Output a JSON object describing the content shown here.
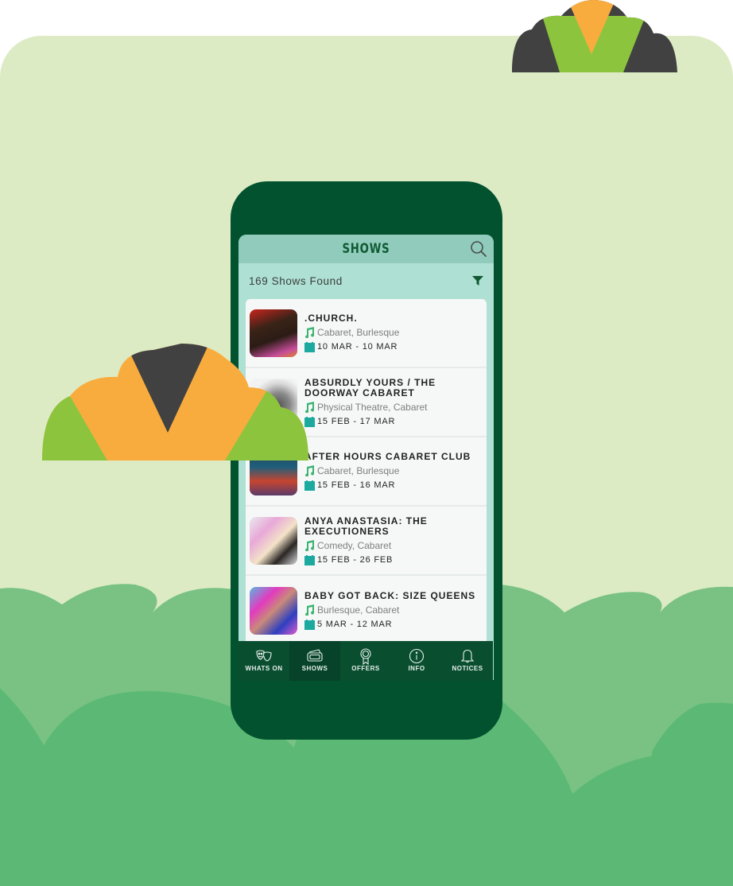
{
  "colors": {
    "panel_bg": "#ddebc5",
    "hill_light": "#79c283",
    "hill_dark": "#5cb975",
    "phone_body": "#02522f",
    "header_bg": "#90cbbb",
    "list_bg": "#aee0d3",
    "accent_teal": "#1ba9a0",
    "accent_green": "#3cb371",
    "cloud_orange": "#f9ac3e",
    "cloud_green": "#8dc43e",
    "cloud_dark": "#414141"
  },
  "app": {
    "title": "SHOWS",
    "results": "169 Shows Found"
  },
  "shows": [
    {
      "title": ".CHURCH.",
      "genres": "Cabaret, Burlesque",
      "dates": "10 MAR - 10 MAR"
    },
    {
      "title": "ABSURDLY YOURS / THE DOORWAY CABARET",
      "genres": "Physical Theatre, Cabaret",
      "dates": "15 FEB - 17 MAR"
    },
    {
      "title": "AFTER HOURS CABARET CLUB",
      "genres": "Cabaret, Burlesque",
      "dates": "15 FEB - 16 MAR"
    },
    {
      "title": "ANYA ANASTASIA: THE EXECUTIONERS",
      "genres": "Comedy, Cabaret",
      "dates": "15 FEB - 26 FEB"
    },
    {
      "title": "BABY GOT BACK: SIZE QUEENS",
      "genres": "Burlesque, Cabaret",
      "dates": "5 MAR - 12 MAR"
    }
  ],
  "tabs": [
    {
      "label": "WHATS ON",
      "icon": "theatre-masks-icon"
    },
    {
      "label": "SHOWS",
      "icon": "tickets-icon",
      "active": true
    },
    {
      "label": "OFFERS",
      "icon": "award-ribbon-icon"
    },
    {
      "label": "INFO",
      "icon": "info-icon"
    },
    {
      "label": "NOTICES",
      "icon": "bell-icon"
    }
  ]
}
